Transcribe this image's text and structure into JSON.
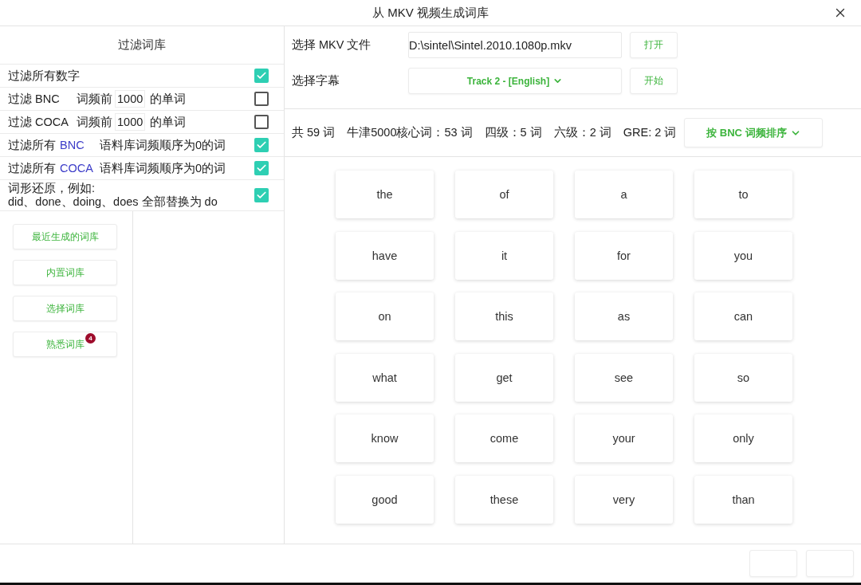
{
  "window": {
    "title": "从 MKV 视频生成词库"
  },
  "filter_panel": {
    "title": "过滤词库",
    "filters": [
      {
        "kind": "plain",
        "label": "过滤所有数字",
        "checked": true
      },
      {
        "kind": "threshold",
        "prefix": "过滤 BNC",
        "middle": "词频前",
        "value": "1000",
        "suffix": "的单词",
        "checked": false
      },
      {
        "kind": "threshold",
        "prefix": "过滤 COCA",
        "middle": "词频前",
        "value": "1000",
        "suffix": "的单词",
        "checked": false
      },
      {
        "kind": "corpus",
        "prefix": "过滤所有",
        "corpus": "BNC",
        "suffix": "语料库词频顺序为0的词",
        "checked": true
      },
      {
        "kind": "corpus",
        "prefix": "过滤所有",
        "corpus": "COCA",
        "suffix": "语料库词频顺序为0的词",
        "checked": true
      },
      {
        "kind": "lemma",
        "lines": [
          "词形还原，例如:",
          "did、done、doing、does 全部替换为 do"
        ],
        "checked": true
      }
    ]
  },
  "library_buttons": [
    {
      "label": "最近生成的词库"
    },
    {
      "label": "内置词库"
    },
    {
      "label": "选择词库"
    },
    {
      "label": "熟悉词库",
      "badge": "4"
    }
  ],
  "source": {
    "file_label": "选择 MKV 文件",
    "file_value": "D:\\sintel\\Sintel.2010.1080p.mkv",
    "open_button": "打开",
    "subtitle_label": "选择字幕",
    "subtitle_select": "Track 2 - [English]",
    "start_button": "开始"
  },
  "stats": {
    "items": [
      "共 59 词",
      "牛津5000核心词：53 词",
      "四级：5 词",
      "六级：2 词",
      "GRE: 2 词"
    ],
    "sort_select": "按 BNC 词频排序"
  },
  "words": [
    "the",
    "of",
    "a",
    "to",
    "have",
    "it",
    "for",
    "you",
    "on",
    "this",
    "as",
    "can",
    "what",
    "get",
    "see",
    "so",
    "know",
    "come",
    "your",
    "only",
    "good",
    "these",
    "very",
    "than"
  ]
}
